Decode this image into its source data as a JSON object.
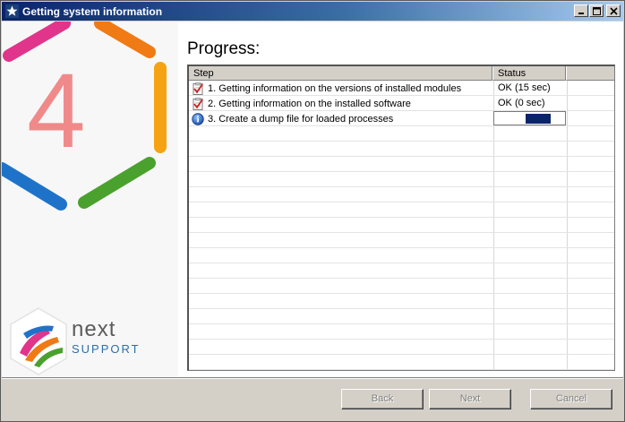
{
  "window": {
    "title": "Getting system information",
    "controls": {
      "minimize": "minimize",
      "maximize": "maximize",
      "close": "close"
    }
  },
  "side": {
    "logo_digit": "4",
    "brand_word": "next",
    "brand_sub": "SUPPORT"
  },
  "main": {
    "heading": "Progress:",
    "grid": {
      "columns": [
        "Step",
        "Status",
        ""
      ],
      "rows": [
        {
          "step": "1. Getting information on the versions of installed modules",
          "status": "OK (15 sec)",
          "icon": "checklist-done-icon",
          "state": "done"
        },
        {
          "step": "2. Getting information on the installed software",
          "status": "OK (0 sec)",
          "icon": "checklist-done-icon",
          "state": "done"
        },
        {
          "step": "3. Create a dump file for loaded processes",
          "status": "",
          "icon": "info-icon",
          "state": "running"
        }
      ]
    }
  },
  "footer": {
    "back_label": "Back",
    "next_label": "Next",
    "cancel_label": "Cancel"
  }
}
